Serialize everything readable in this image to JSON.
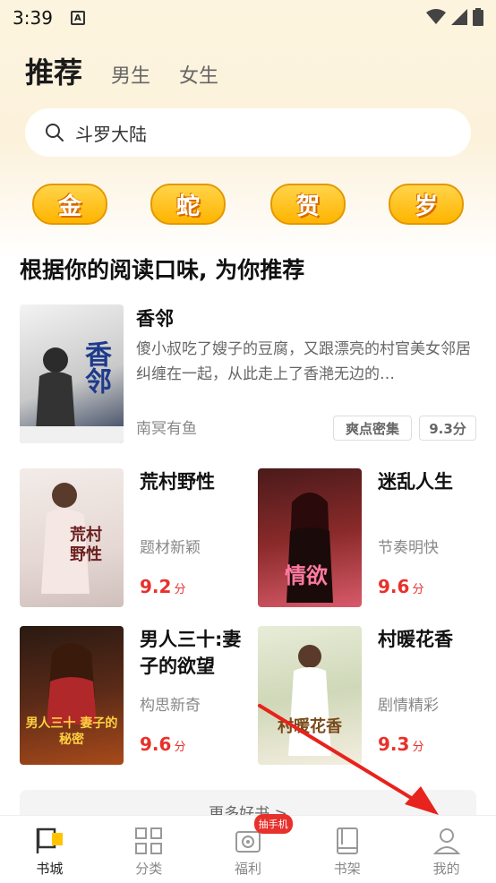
{
  "status": {
    "time": "3:39",
    "notif_letter": "A"
  },
  "tabs": {
    "recommend": "推荐",
    "male": "男生",
    "female": "女生"
  },
  "search": {
    "placeholder": "斗罗大陆"
  },
  "festive": [
    "金",
    "蛇",
    "贺",
    "岁"
  ],
  "section": {
    "title": "根据你的阅读口味, 为你推荐"
  },
  "featured": {
    "title": "香邻",
    "desc": "傻小叔吃了嫂子的豆腐，又跟漂亮的村官美女邻居纠缠在一起，从此走上了香滟无边的…",
    "author": "南冥有鱼",
    "tags": [
      "爽点密集",
      "9.3分"
    ],
    "cover_text": "香邻"
  },
  "books": [
    {
      "title": "荒村野性",
      "tag": "题材新颖",
      "score": "9.2",
      "unit": "分",
      "cover_text": "荒村野性"
    },
    {
      "title": "迷乱人生",
      "tag": "节奏明快",
      "score": "9.6",
      "unit": "分",
      "cover_text": "情欲"
    },
    {
      "title": "男人三十:妻子的欲望",
      "tag": "构思新奇",
      "score": "9.6",
      "unit": "分",
      "cover_text": "男人三十 妻子的秘密"
    },
    {
      "title": "村暖花香",
      "tag": "剧情精彩",
      "score": "9.3",
      "unit": "分",
      "cover_text": "村暖花香"
    }
  ],
  "more": "更多好书 >",
  "nav": [
    {
      "label": "书城",
      "icon": "flag-icon",
      "active": true
    },
    {
      "label": "分类",
      "icon": "grid-icon",
      "active": false
    },
    {
      "label": "福利",
      "icon": "gift-icon",
      "active": false,
      "badge": "抽手机"
    },
    {
      "label": "书架",
      "icon": "bookshelf-icon",
      "active": false
    },
    {
      "label": "我的",
      "icon": "user-icon",
      "active": false
    }
  ],
  "colors": {
    "accent": "#e8312c",
    "festive_gold": "#ffb400",
    "bg_top": "#fdf4df"
  }
}
